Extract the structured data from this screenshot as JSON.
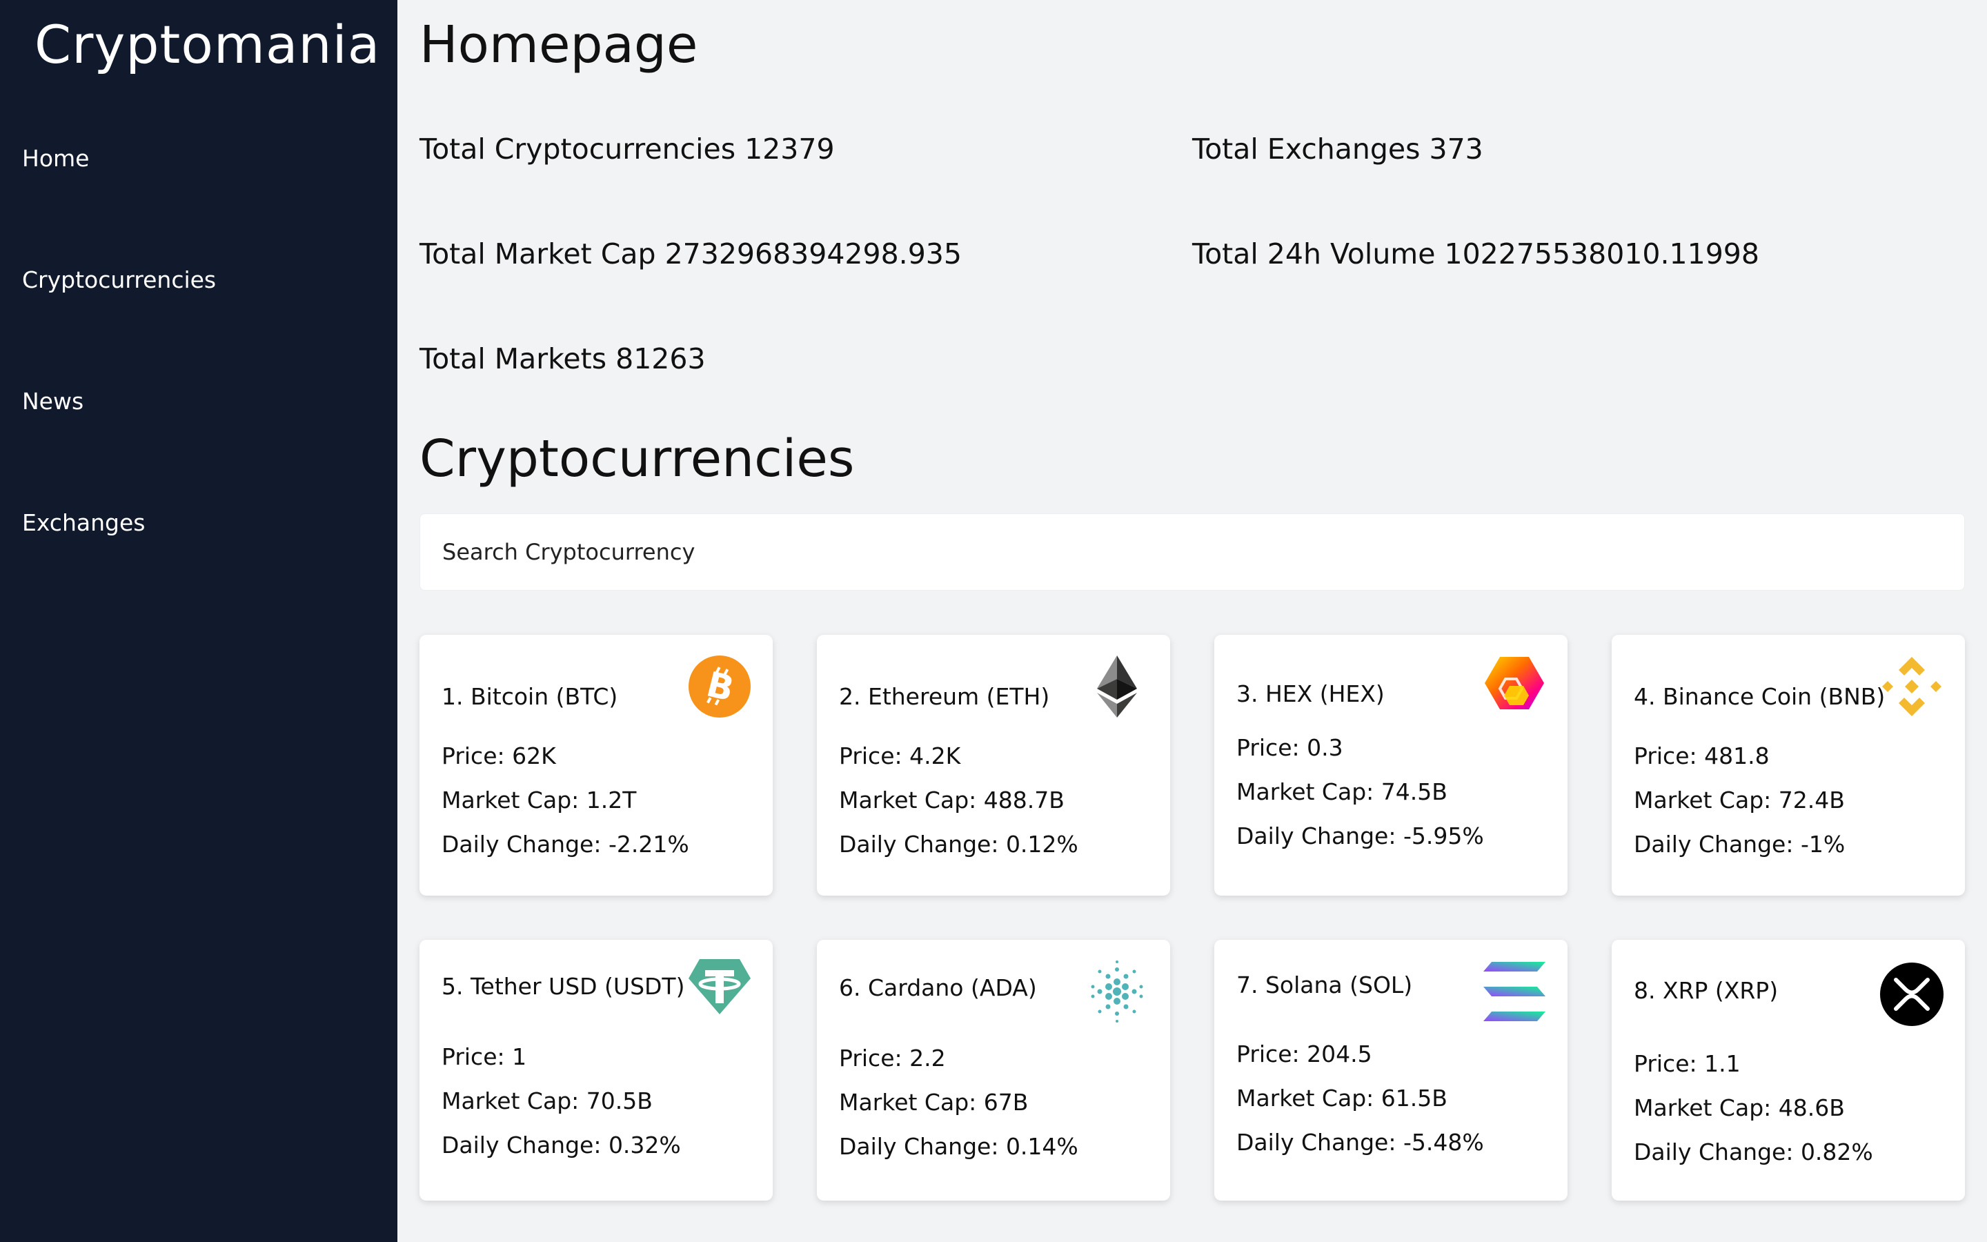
{
  "sidebar": {
    "brand": "Cryptomania",
    "items": [
      {
        "label": "Home"
      },
      {
        "label": "Cryptocurrencies"
      },
      {
        "label": "News"
      },
      {
        "label": "Exchanges"
      }
    ]
  },
  "main": {
    "homepage_title": "Homepage",
    "stats": {
      "total_cryptocurrencies": "Total Cryptocurrencies 12379",
      "total_exchanges": "Total Exchanges 373",
      "total_market_cap": "Total Market Cap 2732968394298.935",
      "total_24h_volume": "Total 24h Volume 102275538010.11998",
      "total_markets": "Total Markets 81263"
    },
    "crypto_title": "Cryptocurrencies",
    "search": {
      "placeholder": "Search Cryptocurrency",
      "value": ""
    },
    "coins": [
      {
        "title": "1. Bitcoin (BTC)",
        "price": "Price: 62K",
        "market_cap": "Market Cap: 1.2T",
        "daily_change": "Daily Change: -2.21%",
        "icon": "bitcoin-icon",
        "color": "#f7931a"
      },
      {
        "title": "2. Ethereum (ETH)",
        "price": "Price: 4.2K",
        "market_cap": "Market Cap: 488.7B",
        "daily_change": "Daily Change: 0.12%",
        "icon": "ethereum-icon",
        "color": "#343434"
      },
      {
        "title": "3. HEX (HEX)",
        "price": "Price: 0.3",
        "market_cap": "Market Cap: 74.5B",
        "daily_change": "Daily Change: -5.95%",
        "icon": "hex-icon",
        "color": "#e83a8c"
      },
      {
        "title": "4. Binance Coin (BNB)",
        "price": "Price: 481.8",
        "market_cap": "Market Cap: 72.4B",
        "daily_change": "Daily Change: -1%",
        "icon": "binance-icon",
        "color": "#f3ba2f"
      },
      {
        "title": "5. Tether USD (USDT)",
        "price": "Price: 1",
        "market_cap": "Market Cap: 70.5B",
        "daily_change": "Daily Change: 0.32%",
        "icon": "tether-icon",
        "color": "#50af95"
      },
      {
        "title": "6. Cardano (ADA)",
        "price": "Price: 2.2",
        "market_cap": "Market Cap: 67B",
        "daily_change": "Daily Change: 0.14%",
        "icon": "cardano-icon",
        "color": "#4fb3b8"
      },
      {
        "title": "7. Solana (SOL)",
        "price": "Price: 204.5",
        "market_cap": "Market Cap: 61.5B",
        "daily_change": "Daily Change: -5.48%",
        "icon": "solana-icon",
        "color": "#9945ff"
      },
      {
        "title": "8. XRP (XRP)",
        "price": "Price: 1.1",
        "market_cap": "Market Cap: 48.6B",
        "daily_change": "Daily Change: 0.82%",
        "icon": "xrp-icon",
        "color": "#000000"
      }
    ]
  }
}
